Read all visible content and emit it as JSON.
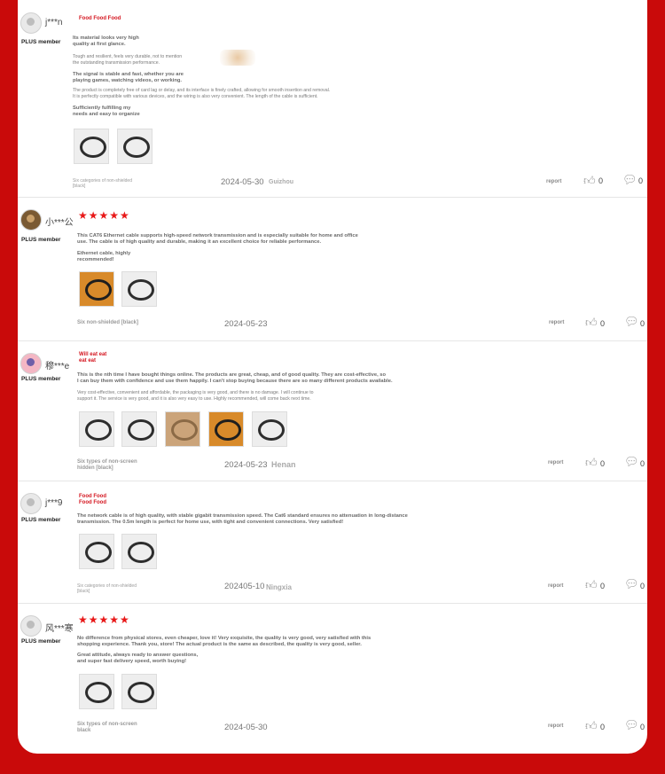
{
  "reviews": [
    {
      "username": "j***n",
      "badge": "PLUS member",
      "tag": "Food Food Food",
      "stars": "",
      "paragraphs": [
        "Its material looks very high\n quality at first glance.",
        "Tough and resilient, feels very durable, not to mention\n the outstanding transmission performance.",
        "The signal is stable and fast, whether you are\n playing games, watching videos, or working.",
        "The product is completely free of card lag or delay, and its interface is finely crafted, allowing for smooth insertion and removal.\n It is perfectly compatible with various devices, and the wiring is also very convenient. The length of the cable is sufficient.",
        "Sufficiently fulfilling my\n needs and easy to organize"
      ],
      "meta": "Six categories of non-shielded\n [black]",
      "date": "2024-05-30",
      "location": "Guizhou",
      "report": "report",
      "likes": "0",
      "comments": "0"
    },
    {
      "username": "小***公",
      "badge": "PLUS member",
      "tag": "",
      "stars": "★★★★★",
      "paragraphs": [
        "This CAT6 Ethernet cable supports high-speed network transmission and is especially suitable for home and office\n use. The cable is of high quality and durable, making it an excellent choice for reliable performance.",
        "Ethernet cable, highly\n recommended!"
      ],
      "meta": "Six non-shielded [black]",
      "date": "2024-05-23",
      "location": "",
      "report": "report",
      "likes": "0",
      "comments": "0"
    },
    {
      "username": "穆***e",
      "badge": "PLUS member",
      "tag": "Will eat eat\n eat eat",
      "stars": "",
      "paragraphs": [
        "This is the nth time I have bought things online. The products are great, cheap, and of good quality. They are cost-effective, so\n I can buy them with confidence and use them happily. I can't stop buying because there are so many different products available.",
        "Very cost-effective, convenient and affordable, the packaging is very good, and there is no damage. I will continue to\n support it. The service is very good, and it is also very easy to use. Highly recommended, will come back next time."
      ],
      "meta": "Six types of non-screen\n hidden [black]",
      "date": "2024-05-23",
      "location": "Henan",
      "report": "report",
      "likes": "0",
      "comments": "0"
    },
    {
      "username": "j***9",
      "badge": "PLUS member",
      "tag": "Food Food\n Food Food",
      "stars": "",
      "paragraphs": [
        "The network cable is of high quality, with stable gigabit transmission speed. The Cat6 standard ensures no attenuation in long-distance\n transmission. The 0.5m length is perfect for home use, with tight and convenient connections. Very satisfied!"
      ],
      "meta": "Six categories of non-shielded\n [black]",
      "date": "202405-10",
      "location": "Ningxia",
      "report": "report",
      "likes": "0",
      "comments": "0"
    },
    {
      "username": "风***寒",
      "badge": "PLUS member",
      "tag": "",
      "stars": "★★★★★",
      "paragraphs": [
        "No difference from physical stores, even cheaper, love it! Very exquisite, the quality is very good, very satisfied with this\n shopping experience. Thank you, store! The actual product is the same as described, the quality is very good, seller.",
        "Great attitude, always ready to answer questions,\n and super fast delivery speed, worth buying!"
      ],
      "meta": "Six types of non-screen\n black",
      "date": "2024-05-30",
      "location": "",
      "report": "report",
      "likes": "0",
      "comments": "0"
    }
  ],
  "icons": {
    "like": "thumbs-up-icon",
    "comment": "comment-icon"
  },
  "colors": {
    "page_background": "#c90a0a",
    "tag_red": "#d4141e",
    "star_red": "#e81818"
  }
}
